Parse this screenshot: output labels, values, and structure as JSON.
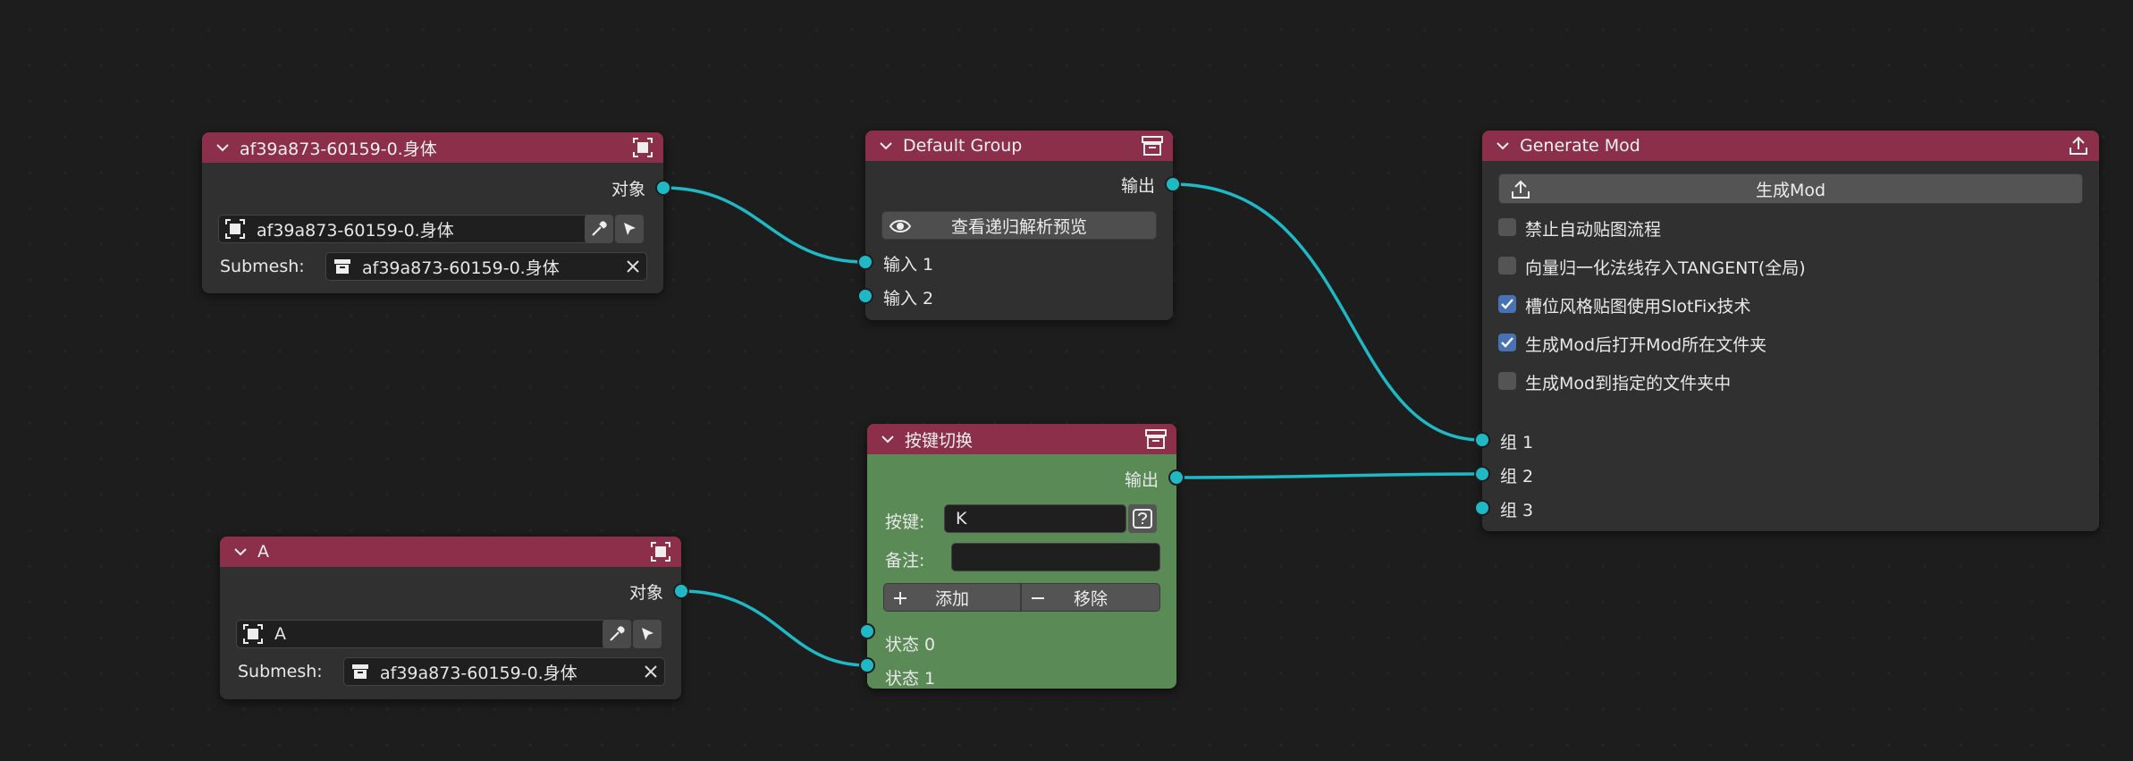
{
  "nodes": {
    "object1": {
      "title": "af39a873-60159-0.身体",
      "output_label": "对象",
      "object_value": "af39a873-60159-0.身体",
      "submesh_label": "Submesh:",
      "submesh_value": "af39a873-60159-0.身体"
    },
    "object2": {
      "title": "A",
      "output_label": "对象",
      "object_value": "A",
      "submesh_label": "Submesh:",
      "submesh_value": "af39a873-60159-0.身体"
    },
    "default_group": {
      "title": "Default Group",
      "output_label": "输出",
      "preview_button": "查看递归解析预览",
      "inputs": [
        "输入 1",
        "输入 2"
      ]
    },
    "key_switch": {
      "title": "按键切换",
      "output_label": "输出",
      "key_label": "按键:",
      "key_value": "K",
      "note_label": "备注:",
      "note_value": "",
      "add_label": "添加",
      "remove_label": "移除",
      "states": [
        "状态 0",
        "状态 1"
      ]
    },
    "generate_mod": {
      "title": "Generate Mod",
      "generate_button": "生成Mod",
      "options": [
        {
          "label": "禁止自动贴图流程",
          "checked": false
        },
        {
          "label": "向量归一化法线存入TANGENT(全局)",
          "checked": false
        },
        {
          "label": "槽位风格贴图使用SlotFix技术",
          "checked": true
        },
        {
          "label": "生成Mod后打开Mod所在文件夹",
          "checked": true
        },
        {
          "label": "生成Mod到指定的文件夹中",
          "checked": false
        }
      ],
      "groups": [
        "组 1",
        "组 2",
        "组 3"
      ]
    }
  },
  "colors": {
    "header": "#8c2f4b",
    "node_body": "#303030",
    "key_switch_body": "#5a8a55",
    "socket": "#1fb9c5",
    "wire": "#1fb9c5",
    "checkbox_checked": "#4772b3"
  },
  "icons": {
    "collapse": "chevron-down-icon",
    "object_node": "object-frame-icon",
    "group_node": "archive-box-icon",
    "export": "export-upload-icon",
    "eyedropper": "eyedropper-icon",
    "cursor": "cursor-pointer-icon",
    "clear": "close-icon",
    "eye": "eye-icon",
    "plus": "plus-icon",
    "minus": "minus-icon",
    "key": "question-key-icon"
  }
}
